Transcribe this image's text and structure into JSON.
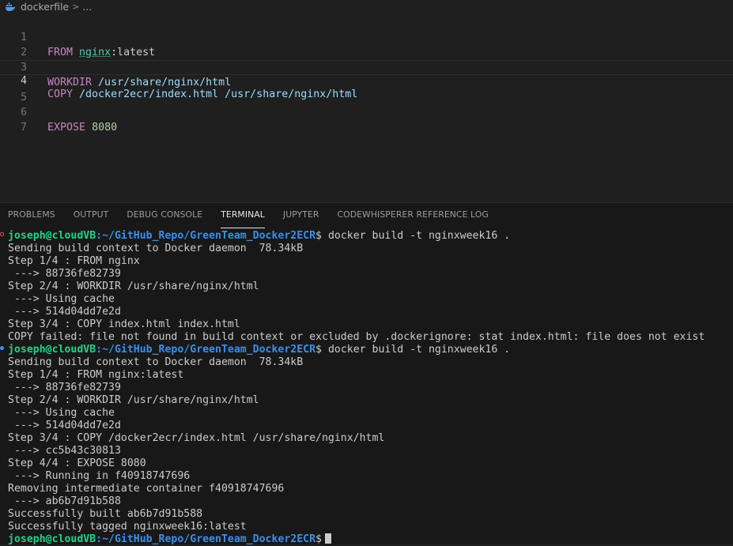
{
  "breadcrumb": {
    "file": "dockerfile",
    "separator": ">",
    "rest": "..."
  },
  "editor": {
    "lines": [
      {
        "no": "1",
        "kw": "FROM",
        "image": "nginx",
        "tag": ":latest"
      },
      {
        "no": "2"
      },
      {
        "no": "3",
        "kw": "WORKDIR",
        "arg": " /usr/share/nginx/html"
      },
      {
        "no": "4",
        "kw": "COPY",
        "arg": " /docker2ecr/index.html /usr/share/nginx/html"
      },
      {
        "no": "5"
      },
      {
        "no": "6",
        "kw": "EXPOSE",
        "num": "8080"
      },
      {
        "no": "7"
      }
    ]
  },
  "panel": {
    "tabs": [
      "PROBLEMS",
      "OUTPUT",
      "DEBUG CONSOLE",
      "TERMINAL",
      "JUPYTER",
      "CODEWHISPERER REFERENCE LOG"
    ],
    "active_tab": "TERMINAL"
  },
  "terminal": {
    "user_host": "joseph@cloudVB",
    "path": ":~/GitHub_Repo/GreenTeam_Docker2ECR",
    "prompt_symbol": "$",
    "command": " docker build -t nginxweek16 .",
    "run1": [
      "Sending build context to Docker daemon  78.34kB",
      "Step 1/4 : FROM nginx",
      " ---> 88736fe82739",
      "Step 2/4 : WORKDIR /usr/share/nginx/html",
      " ---> Using cache",
      " ---> 514d04dd7e2d",
      "Step 3/4 : COPY index.html index.html",
      "COPY failed: file not found in build context or excluded by .dockerignore: stat index.html: file does not exist"
    ],
    "run2": [
      "Sending build context to Docker daemon  78.34kB",
      "Step 1/4 : FROM nginx:latest",
      " ---> 88736fe82739",
      "Step 2/4 : WORKDIR /usr/share/nginx/html",
      " ---> Using cache",
      " ---> 514d04dd7e2d",
      "Step 3/4 : COPY /docker2ecr/index.html /usr/share/nginx/html",
      " ---> cc5b43c30813",
      "Step 4/4 : EXPOSE 8080",
      " ---> Running in f40918747696",
      "Removing intermediate container f40918747696",
      " ---> ab6b7d91b588",
      "Successfully built ab6b7d91b588",
      "Successfully tagged nginxweek16:latest"
    ]
  },
  "colors": {
    "background": "#1f1f1f",
    "keyword": "#c586c0",
    "user": "#23d18b",
    "path": "#3b8eea",
    "error_dot": "#f14c4c",
    "info_dot": "#3794ff"
  }
}
